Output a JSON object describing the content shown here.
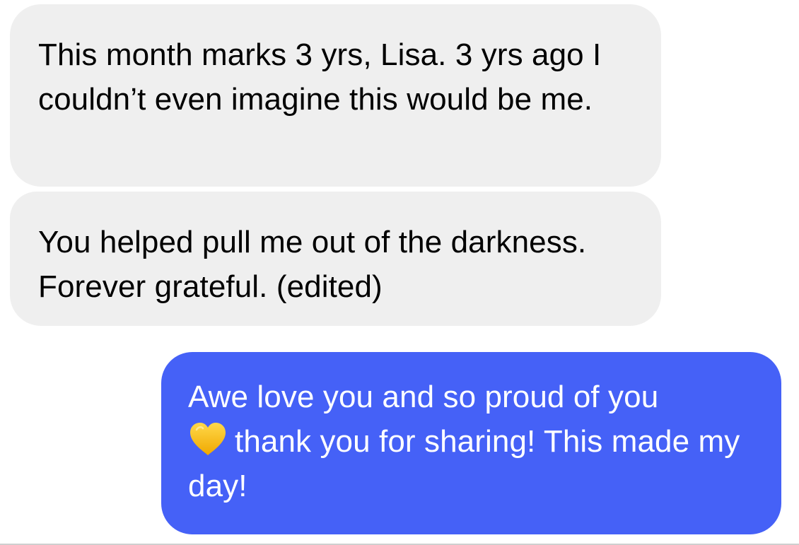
{
  "conversation": {
    "messages": [
      {
        "direction": "incoming",
        "text": "This month marks 3 yrs, Lisa. 3 yrs ago I couldn’t even imagine this would be me."
      },
      {
        "direction": "incoming",
        "text": "You helped pull me out of the darkness. Forever grateful. (edited)"
      },
      {
        "direction": "outgoing",
        "text_before_icon": "Awe love you and so proud of you",
        "icon": "yellow-heart-icon",
        "text_after_icon": "thank you for sharing! This made my day!"
      }
    ]
  },
  "colors": {
    "incoming_bubble": "#efefef",
    "outgoing_bubble": "#4561f7",
    "incoming_text": "#000000",
    "outgoing_text": "#ffffff",
    "heart": "#f7c21b"
  }
}
